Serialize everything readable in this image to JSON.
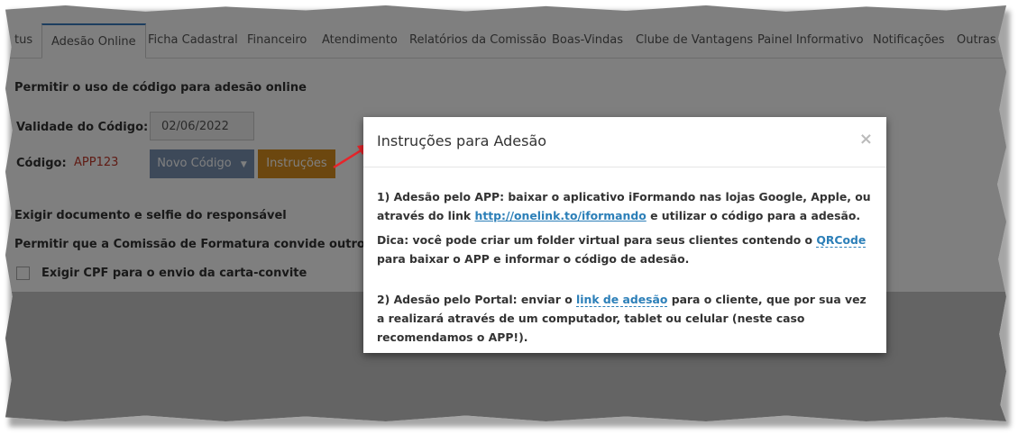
{
  "tabs": [
    {
      "label": "tus"
    },
    {
      "label": "Adesão Online",
      "active": true
    },
    {
      "label": "Ficha Cadastral"
    },
    {
      "label": "Financeiro"
    },
    {
      "label": "Atendimento"
    },
    {
      "label": "Relatórios da Comissão"
    },
    {
      "label": "Boas-Vindas"
    },
    {
      "label": "Clube de Vantagens"
    },
    {
      "label": "Painel Informativo"
    },
    {
      "label": "Notificações"
    },
    {
      "label": "Outras C"
    }
  ],
  "form": {
    "allow_online_code": "Permitir o uso de código para adesão online",
    "validity_label": "Validade do Código:",
    "validity_value": "02/06/2022",
    "code_label": "Código:",
    "code_value": "APP123",
    "new_code_button": "Novo Código",
    "instructions_button": "Instruções",
    "require_document": "Exigir documento e selfie do responsável",
    "allow_invite": "Permitir que a Comissão de Formatura convide outros colegas",
    "require_cpf": "Exigir CPF para o envio da carta-convite"
  },
  "modal": {
    "title": "Instruções para Adesão",
    "close": "×",
    "p1_a": "1) Adesão pelo APP: baixar o aplicativo iFormando nas lojas Google, Apple, ou através do link ",
    "p1_link": "http://onelink.to/iformando",
    "p1_b": " e utilizar o código para a adesão.",
    "p2_a": "Dica: você pode criar um folder virtual para seus clientes contendo o ",
    "p2_link": "QRCode",
    "p2_b": " para baixar o APP e informar o código de adesão.",
    "p3_a": "2) Adesão pelo Portal: enviar o ",
    "p3_link": "link de adesão",
    "p3_b": " para o cliente, que por sua vez a realizará através de um computador, tablet ou celular (neste caso recomendamos o APP!)."
  },
  "colors": {
    "tab_accent": "#3b7cbf",
    "code_value": "#c0392b",
    "new_code_button": "#7a93b3",
    "instructions_button": "#d98f1e",
    "link": "#2c7fb8",
    "arrow": "#e8242a"
  }
}
